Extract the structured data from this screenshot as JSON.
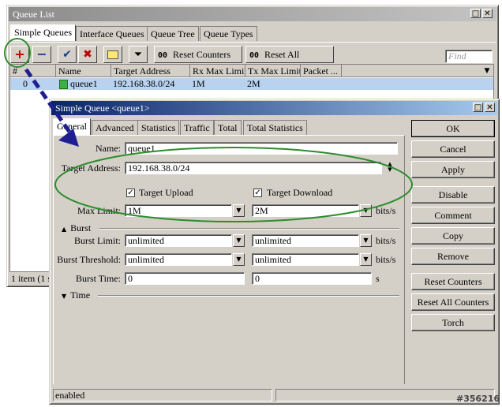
{
  "queue_list": {
    "title": "Queue List",
    "tabs": [
      "Simple Queues",
      "Interface Queues",
      "Queue Tree",
      "Queue Types"
    ],
    "toolbar": {
      "reset_counters": "Reset Counters",
      "reset_all_counters": "Reset All Counters",
      "oo": "00",
      "find_placeholder": "Find"
    },
    "columns": [
      "#",
      "Name",
      "Target Address",
      "Rx Max Limit",
      "Tx Max Limit",
      "Packet ..."
    ],
    "rows": [
      {
        "index": "0",
        "name": "queue1",
        "target": "192.168.38.0/24",
        "rx": "1M",
        "tx": "2M",
        "packet": ""
      }
    ],
    "status": "1 item (1 s"
  },
  "dialog": {
    "title": "Simple Queue <queue1>",
    "tabs": [
      "General",
      "Advanced",
      "Statistics",
      "Traffic",
      "Total",
      "Total Statistics"
    ],
    "name_label": "Name:",
    "name_value": "queue1",
    "target_address_label": "Target Address:",
    "target_address_value": "192.168.38.0/24",
    "target_upload_label": "Target Upload",
    "target_download_label": "Target Download",
    "max_limit_label": "Max Limit:",
    "max_limit_upload": "1M",
    "max_limit_download": "2M",
    "unit": "bits/s",
    "burst_section": "Burst",
    "burst_limit_label": "Burst Limit:",
    "burst_limit_upload": "unlimited",
    "burst_limit_download": "unlimited",
    "burst_threshold_label": "Burst Threshold:",
    "burst_threshold_upload": "unlimited",
    "burst_threshold_download": "unlimited",
    "burst_time_label": "Burst Time:",
    "burst_time_upload": "0",
    "burst_time_download": "0",
    "burst_time_unit": "s",
    "time_section": "Time",
    "status": "enabled",
    "buttons": {
      "ok": "OK",
      "cancel": "Cancel",
      "apply": "Apply",
      "disable": "Disable",
      "comment": "Comment",
      "copy": "Copy",
      "remove": "Remove",
      "reset_counters": "Reset Counters",
      "reset_all_counters": "Reset All Counters",
      "torch": "Torch"
    }
  },
  "watermark": "#356216",
  "colors": {
    "annotation_green": "#2e8b2e",
    "annotation_arrow": "#1f1f8f",
    "selection": "#b8d2ef"
  }
}
